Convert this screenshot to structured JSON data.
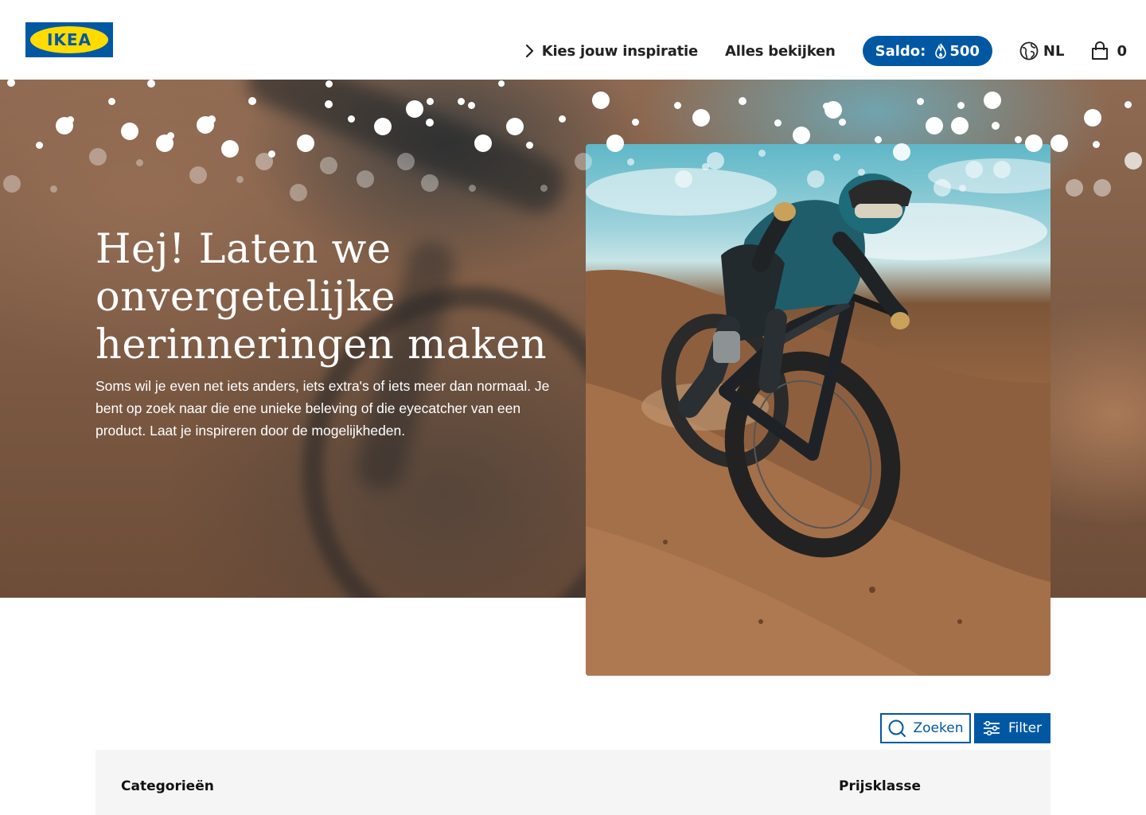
{
  "header": {
    "logo_text": "IKEA",
    "nav": {
      "inspiration": "Kies jouw inspiratie",
      "all": "Alles bekijken"
    },
    "saldo": {
      "label": "Saldo:",
      "value": "500"
    },
    "language": "NL",
    "cart_count": "0"
  },
  "hero": {
    "title_lines": [
      "Hej! Laten we",
      "onvergetelijke",
      "herinneringen maken"
    ],
    "subtitle": "Soms wil je even net iets anders, iets extra's of iets meer dan normaal. Je bent op zoek naar die ene unieke beleving of die eyecatcher van een product. Laat je inspireren door de mogelijkheden."
  },
  "actions": {
    "search_label": "Zoeken",
    "filter_label": "Filter"
  },
  "filter_panel": {
    "categories_label": "Categorieën",
    "price_label": "Prijsklasse"
  },
  "colors": {
    "brand_blue": "#0058a3",
    "brand_yellow": "#ffdb00",
    "panel_bg": "#f5f5f5"
  },
  "icons": [
    "chevron-right-icon",
    "flame-icon",
    "globe-icon",
    "shopping-bag-icon",
    "search-icon",
    "filter-sliders-icon"
  ]
}
